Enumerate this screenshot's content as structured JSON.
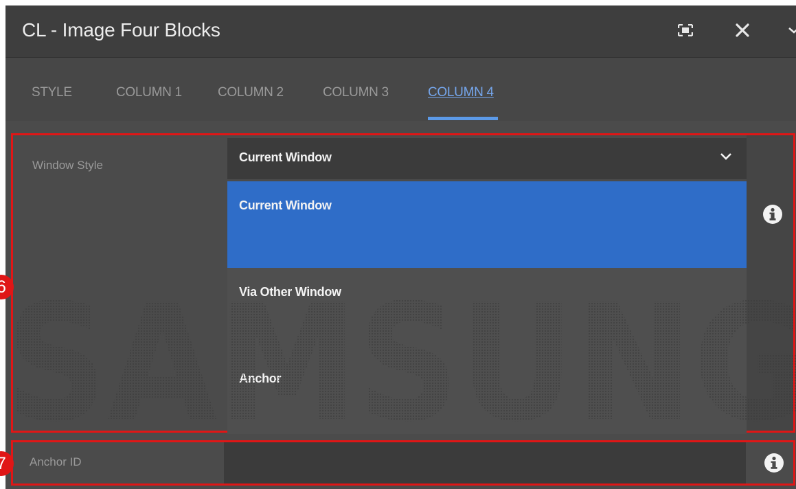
{
  "dialog": {
    "title": "CL - Image Four Blocks"
  },
  "header_icons": {
    "fullscreen": "fullscreen-icon",
    "close": "close-icon",
    "overflow": "chevron-down-icon"
  },
  "tabs": [
    {
      "label": "STYLE",
      "active": false
    },
    {
      "label": "COLUMN 1",
      "active": false
    },
    {
      "label": "COLUMN 2",
      "active": false
    },
    {
      "label": "COLUMN 3",
      "active": false
    },
    {
      "label": "COLUMN 4",
      "active": true
    }
  ],
  "section6": {
    "marker": "6",
    "label": "Window Style",
    "selected_value": "Current Window",
    "options": [
      "Current Window",
      "Via Other Window",
      "Anchor"
    ],
    "highlighted_option": "Current Window"
  },
  "section7": {
    "marker": "7",
    "label": "Anchor ID",
    "value": ""
  },
  "watermark": {
    "text": "SAMSUNG"
  },
  "colors": {
    "accent": "#5c9ae8",
    "selection": "#2f6dc8",
    "marker": "#e01616",
    "panel": "#4b4b4b"
  }
}
